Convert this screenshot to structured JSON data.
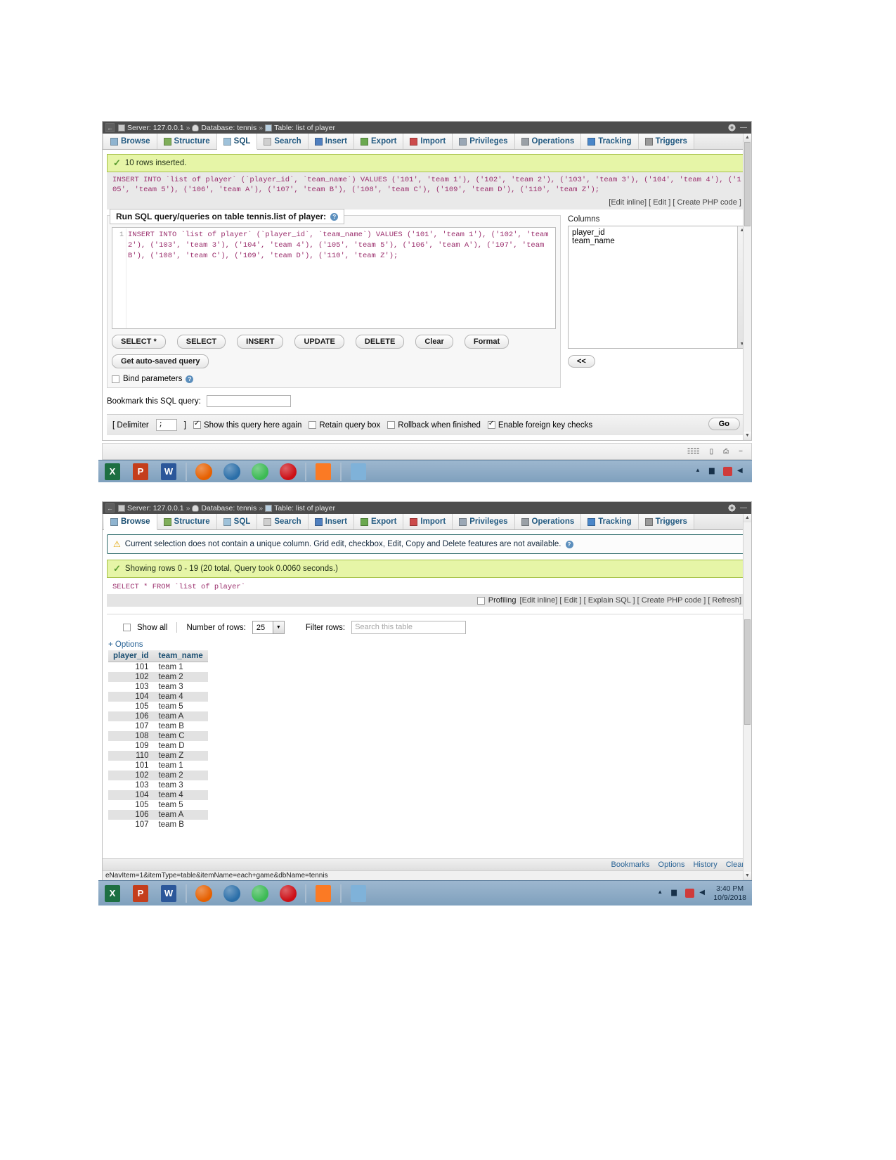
{
  "panel1": {
    "breadcrumb": {
      "back": "←",
      "server_label": "Server: 127.0.0.1",
      "sep1": "»",
      "database_label": "Database: tennis",
      "sep2": "»",
      "table_label": "Table: list of player"
    },
    "tabs": [
      {
        "label": "Browse",
        "icon": "browse-icon",
        "active": false
      },
      {
        "label": "Structure",
        "icon": "structure-icon",
        "active": false
      },
      {
        "label": "SQL",
        "icon": "sql-icon",
        "active": true
      },
      {
        "label": "Search",
        "icon": "search-icon",
        "active": false
      },
      {
        "label": "Insert",
        "icon": "insert-icon",
        "active": false
      },
      {
        "label": "Export",
        "icon": "export-icon",
        "active": false
      },
      {
        "label": "Import",
        "icon": "import-icon",
        "active": false
      },
      {
        "label": "Privileges",
        "icon": "privileges-icon",
        "active": false
      },
      {
        "label": "Operations",
        "icon": "operations-icon",
        "active": false
      },
      {
        "label": "Tracking",
        "icon": "tracking-icon",
        "active": false
      },
      {
        "label": "Triggers",
        "icon": "triggers-icon",
        "active": false
      }
    ],
    "success_message": "10 rows inserted.",
    "sql_echo": "INSERT INTO `list of player` (`player_id`, `team_name`) VALUES ('101', 'team 1'), ('102', 'team 2'), ('103', 'team 3'), ('104', 'team 4'), ('105', 'team 5'), ('106', 'team A'), ('107', 'team B'), ('108', 'team C'), ('109', 'team D'), ('110', 'team Z');",
    "action_links": "[Edit inline] [ Edit ] [ Create PHP code ]",
    "legend": "Run SQL query/queries on table tennis.list of player:",
    "line_number": "1",
    "query_text": "INSERT INTO `list of player` (`player_id`, `team_name`) VALUES ('101', 'team 1'), ('102', 'team 2'), ('103', 'team 3'), ('104', 'team 4'), ('105', 'team 5'), ('106', 'team A'), ('107', 'team B'), ('108', 'team C'), ('109', 'team D'), ('110', 'team Z');",
    "buttons": [
      "SELECT *",
      "SELECT",
      "INSERT",
      "UPDATE",
      "DELETE",
      "Clear",
      "Format"
    ],
    "autosave_button": "Get auto-saved query",
    "bind_parameters_label": "Bind parameters",
    "bookmark_label": "Bookmark this SQL query:",
    "bookmark_value": "",
    "columns_label": "Columns",
    "columns": [
      "player_id",
      "team_name"
    ],
    "move_button": "<<",
    "delimiter_open": "[ Delimiter",
    "delimiter_value": ";",
    "delimiter_close": "]",
    "options": [
      {
        "label": "Show this query here again",
        "checked": true
      },
      {
        "label": "Retain query box",
        "checked": false
      },
      {
        "label": "Rollback when finished",
        "checked": false
      },
      {
        "label": "Enable foreign key checks",
        "checked": true
      }
    ],
    "go_button": "Go"
  },
  "panel2": {
    "breadcrumb": {
      "back": "←",
      "server_label": "Server: 127.0.0.1",
      "sep1": "»",
      "database_label": "Database: tennis",
      "sep2": "»",
      "table_label": "Table: list of player"
    },
    "tabs": [
      {
        "label": "Browse",
        "icon": "browse-icon",
        "active": true
      },
      {
        "label": "Structure",
        "icon": "structure-icon",
        "active": false
      },
      {
        "label": "SQL",
        "icon": "sql-icon",
        "active": false
      },
      {
        "label": "Search",
        "icon": "search-icon",
        "active": false
      },
      {
        "label": "Insert",
        "icon": "insert-icon",
        "active": false
      },
      {
        "label": "Export",
        "icon": "export-icon",
        "active": false
      },
      {
        "label": "Import",
        "icon": "import-icon",
        "active": false
      },
      {
        "label": "Privileges",
        "icon": "privileges-icon",
        "active": false
      },
      {
        "label": "Operations",
        "icon": "operations-icon",
        "active": false
      },
      {
        "label": "Tracking",
        "icon": "tracking-icon",
        "active": false
      },
      {
        "label": "Triggers",
        "icon": "triggers-icon",
        "active": false
      }
    ],
    "warning_message": "Current selection does not contain a unique column. Grid edit, checkbox, Edit, Copy and Delete features are not available.",
    "success_message": "Showing rows 0 - 19 (20 total, Query took 0.0060 seconds.)",
    "sql_echo": "SELECT * FROM `list of player`",
    "profiling_label": "Profiling",
    "profiling_checked": false,
    "action_links": "[Edit inline] [ Edit ] [ Explain SQL ] [ Create PHP code ] [ Refresh]",
    "show_all_label": "Show all",
    "show_all_checked": false,
    "number_of_rows_label": "Number of rows:",
    "number_of_rows_value": "25",
    "filter_rows_label": "Filter rows:",
    "filter_rows_placeholder": "Search this table",
    "plus_options": "+ Options",
    "table": {
      "columns": [
        "player_id",
        "team_name"
      ],
      "rows": [
        [
          "101",
          "team 1"
        ],
        [
          "102",
          "team 2"
        ],
        [
          "103",
          "team 3"
        ],
        [
          "104",
          "team 4"
        ],
        [
          "105",
          "team 5"
        ],
        [
          "106",
          "team A"
        ],
        [
          "107",
          "team B"
        ],
        [
          "108",
          "team C"
        ],
        [
          "109",
          "team D"
        ],
        [
          "110",
          "team Z"
        ],
        [
          "101",
          "team 1"
        ],
        [
          "102",
          "team 2"
        ],
        [
          "103",
          "team 3"
        ],
        [
          "104",
          "team 4"
        ],
        [
          "105",
          "team 5"
        ],
        [
          "106",
          "team A"
        ],
        [
          "107",
          "team B"
        ]
      ]
    },
    "bottom_links": [
      "Bookmarks",
      "Options",
      "History",
      "Clear"
    ],
    "status_text": "eNavItem=1&itemType=table&itemName=each+game&dbName=tennis"
  },
  "taskbar1": {
    "apps": [
      "excel-icon",
      "powerpoint-icon",
      "word-icon",
      "firefox-icon",
      "thunderbird-icon",
      "chrome-icon",
      "opera-icon",
      "xampp-icon",
      "photo-viewer-icon"
    ],
    "tray": [
      "show-hidden-icon",
      "network-icon",
      "security-icon"
    ]
  },
  "taskbar2": {
    "apps": [
      "excel-icon",
      "powerpoint-icon",
      "word-icon",
      "firefox-icon",
      "thunderbird-icon",
      "chrome-icon",
      "opera-icon",
      "xampp-icon",
      "photo-viewer-icon"
    ],
    "clock_time": "3:40 PM",
    "clock_date": "10/9/2018"
  },
  "colors": {
    "success_bg": "#e6f5a7",
    "breadcrumb_bg": "#4d4d4d",
    "tab_link": "#235a81",
    "link": "#2a6496",
    "taskbar": "#7fa0bd"
  }
}
